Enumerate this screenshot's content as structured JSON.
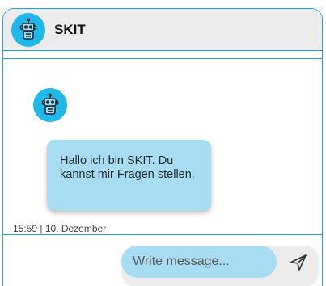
{
  "header": {
    "title": "SKIT",
    "avatar_icon": "robot-icon"
  },
  "messages": [
    {
      "sender_icon": "robot-icon",
      "text": "Hallo ich bin SKIT. Du kannst mir Fragen stellen.",
      "timestamp": "15:59 | 10. Dezember"
    }
  ],
  "composer": {
    "placeholder": "Write message...",
    "send_icon": "send-icon"
  },
  "colors": {
    "accent": "#1aa6d8",
    "avatar_bg": "#20b8e8",
    "bubble_bg": "#a8dcf2",
    "header_bg": "#ececec"
  }
}
